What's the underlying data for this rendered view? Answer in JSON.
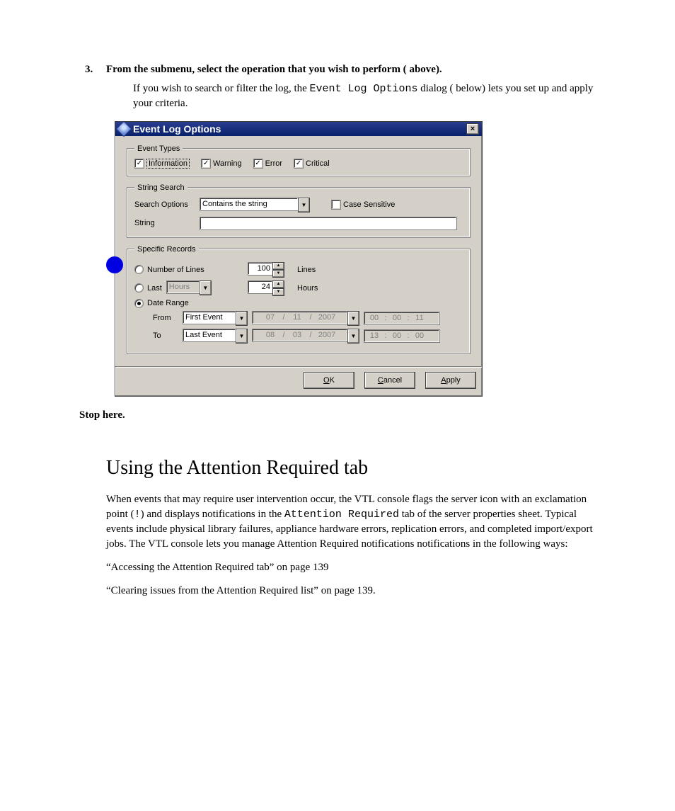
{
  "step": {
    "number": "3.",
    "text_lead": "From the submenu, select the operation that you wish to perform (",
    "text_mid": " above).",
    "para_lead": "If you wish to search or filter the log, the ",
    "para_code": "Event Log Options",
    "para_mid": " dialog (",
    "para_tail": " below) lets you set up and apply your criteria."
  },
  "dialog": {
    "title": "Event Log Options",
    "close": "×",
    "event_types": {
      "legend": "Event Types",
      "items": [
        "Information",
        "Warning",
        "Error",
        "Critical"
      ]
    },
    "string_search": {
      "legend": "String Search",
      "search_options_label": "Search Options",
      "search_options_value": "Contains the string",
      "case_sensitive": "Case Sensitive",
      "string_label": "String",
      "string_value": ""
    },
    "specific": {
      "legend": "Specific Records",
      "num_lines_label": "Number of Lines",
      "num_lines_value": "100",
      "num_lines_unit": "Lines",
      "last_label": "Last",
      "last_unit_value": "Hours",
      "last_value": "24",
      "last_unit_after": "Hours",
      "date_range_label": "Date Range",
      "from_label": "From",
      "from_dropdown": "First Event",
      "from_month": "07",
      "from_day": "11",
      "from_year": "2007",
      "from_hh": "00",
      "from_mm": "00",
      "from_ss": "11",
      "to_label": "To",
      "to_dropdown": "Last Event",
      "to_month": "08",
      "to_day": "03",
      "to_year": "2007",
      "to_hh": "13",
      "to_mm": "00",
      "to_ss": "00"
    },
    "buttons": {
      "ok": "OK",
      "cancel": "Cancel",
      "apply": "Apply"
    }
  },
  "stop": "Stop here.",
  "section": {
    "heading": "Using the Attention Required tab",
    "p_lead": "When events that may require user intervention occur, the VTL console flags the server icon with an exclamation point (",
    "p_bang": "!",
    "p_mid": ") and displays notifications in the ",
    "p_code": "Attention Required",
    "p_tail": " tab of the server properties sheet. Typical events include physical library failures, appliance hardware errors, replication errors, and completed import/export jobs. The VTL console lets you manage Attention Required notifications notifications in the following ways:",
    "xref1": "“Accessing the Attention Required tab” on page 139",
    "xref2": "“Clearing issues from the Attention Required list” on page 139."
  }
}
